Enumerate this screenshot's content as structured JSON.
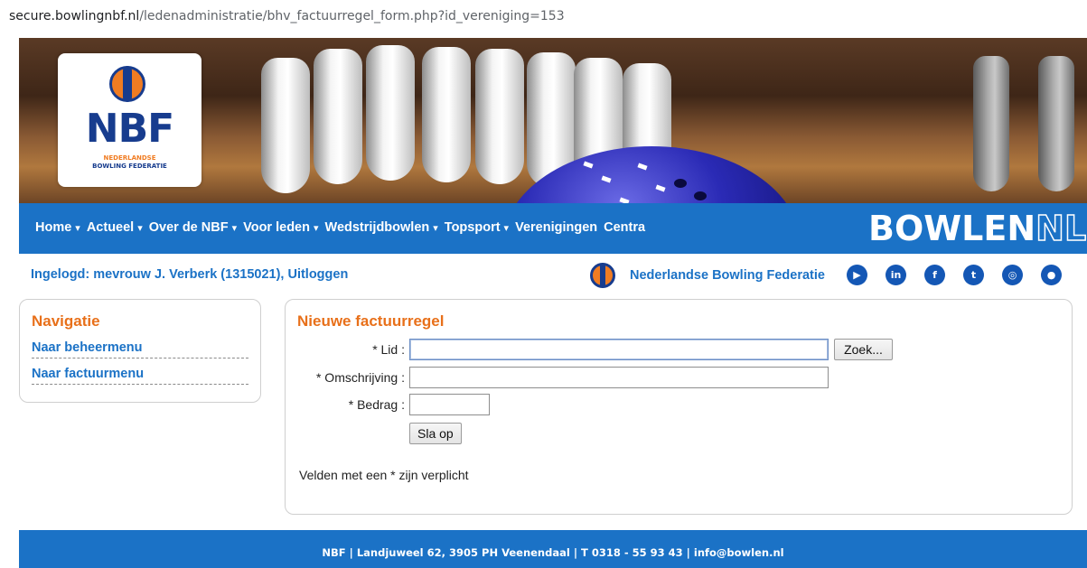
{
  "browser": {
    "url_host": "secure.bowlingnbf.nl",
    "url_path": "/ledenadministratie/bhv_factuurregel_form.php?id_vereniging=153"
  },
  "logo": {
    "name": "NBF",
    "line1": "NEDERLANDSE",
    "line2": "BOWLING FEDERATIE"
  },
  "nav": {
    "items": [
      {
        "label": "Home",
        "caret": "▾"
      },
      {
        "label": "Actueel",
        "caret": "▾"
      },
      {
        "label": "Over de NBF",
        "caret": "▾"
      },
      {
        "label": "Voor leden",
        "caret": "▾"
      },
      {
        "label": "Wedstrijdbowlen",
        "caret": "▾"
      },
      {
        "label": "Topsport",
        "caret": "▾"
      },
      {
        "label": "Verenigingen",
        "caret": ""
      },
      {
        "label": "Centra",
        "caret": ""
      }
    ],
    "brand_main": "BOWLEN",
    "brand_suffix": "NL"
  },
  "login": {
    "text": "Ingelogd: mevrouw J. Verberk (1315021), Uitloggen",
    "federation": "Nederlandse Bowling Federatie"
  },
  "social": [
    "youtube-icon",
    "linkedin-icon",
    "facebook-icon",
    "twitter-icon",
    "instagram-icon",
    "flickr-icon"
  ],
  "navigation_panel": {
    "title": "Navigatie",
    "links": [
      "Naar beheermenu",
      "Naar factuurmenu"
    ]
  },
  "form": {
    "title": "Nieuwe factuurregel",
    "lid_label": "* Lid :",
    "lid_value": "",
    "search_button": "Zoek...",
    "omschrijving_label": "* Omschrijving :",
    "omschrijving_value": "",
    "bedrag_label": "* Bedrag :",
    "bedrag_value": "",
    "save_button": "Sla op",
    "required_hint": "Velden met een * zijn verplicht"
  },
  "footer": {
    "text": "NBF  |  Landjuweel 62, 3905 PH Veenendaal  |  T 0318 - 55 93 43  |  info@bowlen.nl"
  },
  "colors": {
    "brand_blue": "#1b72c6",
    "accent_orange": "#e8701a"
  }
}
